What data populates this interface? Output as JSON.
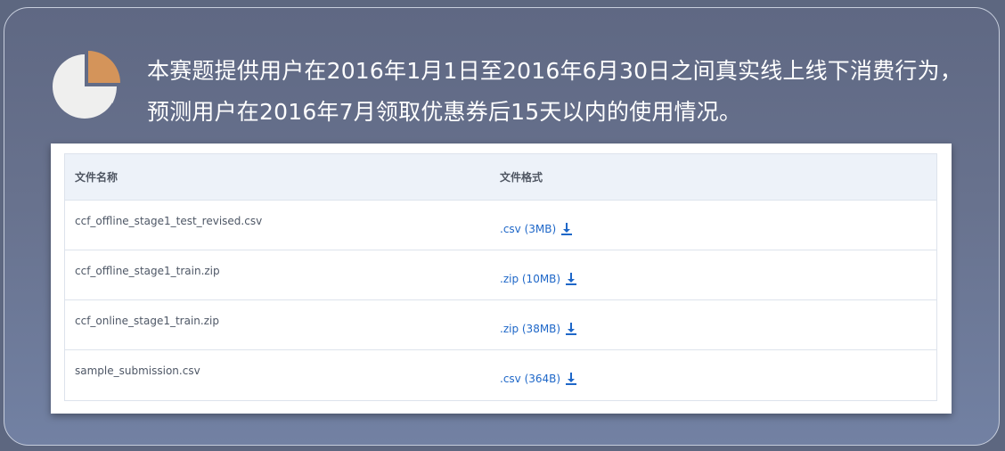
{
  "intro": {
    "line1": "本赛题提供用户在2016年1月1日至2016年6月30日之间真实线上线下消费行为，",
    "line2": "预测用户在2016年7月领取优惠券后15天以内的使用情况。"
  },
  "table": {
    "headers": {
      "file_name": "文件名称",
      "file_format": "文件格式"
    },
    "rows": [
      {
        "file_name": "ccf_offline_stage1_test_revised.csv",
        "format": ".csv (3MB)"
      },
      {
        "file_name": "ccf_offline_stage1_train.zip",
        "format": ".zip (10MB)"
      },
      {
        "file_name": "ccf_online_stage1_train.zip",
        "format": ".zip (38MB)"
      },
      {
        "file_name": "sample_submission.csv",
        "format": ".csv (364B)"
      }
    ]
  },
  "icons": {
    "chart": "pie-chart-icon",
    "download": "download-icon"
  },
  "colors": {
    "pie_main": "#efefee",
    "pie_slice": "#d4945a",
    "link": "#1e67c8"
  }
}
